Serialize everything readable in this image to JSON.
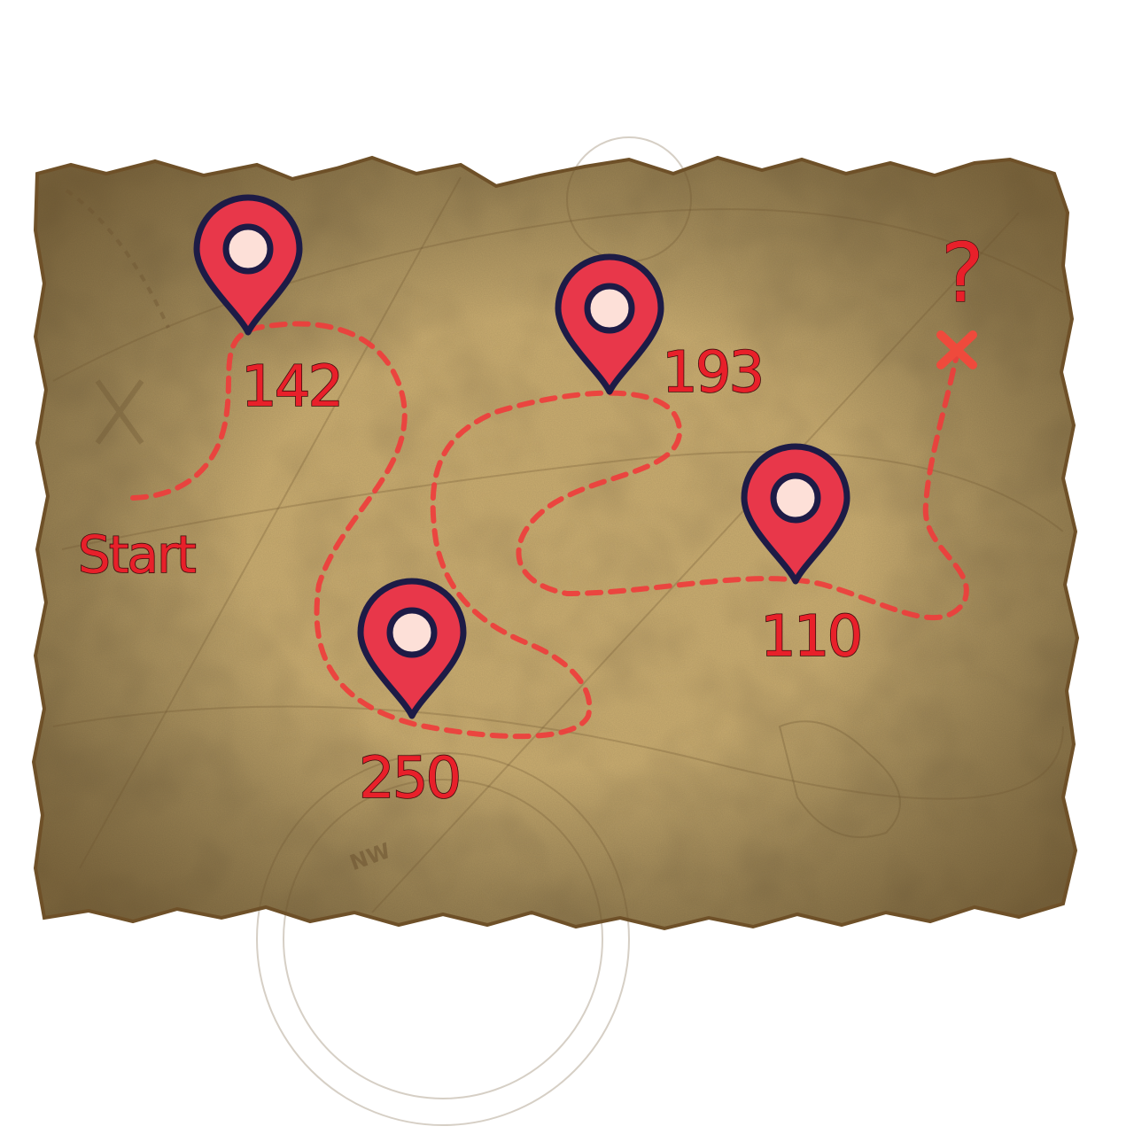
{
  "map": {
    "start_label": "Start",
    "unknown_label": "?",
    "colors": {
      "parchment": "#c9ac6f",
      "parchment_edge": "#6e5028",
      "route": "#ef3b3b",
      "pin_fill": "#e8374a",
      "pin_outline": "#1d1b46",
      "pin_center": "#fde0d8",
      "label_fill": "#e8202a",
      "label_outline": "#3a0c0c"
    },
    "waypoints": [
      {
        "id": "wp1",
        "label": "142",
        "icon": "map-pin-icon"
      },
      {
        "id": "wp2",
        "label": "250",
        "icon": "map-pin-icon"
      },
      {
        "id": "wp3",
        "label": "193",
        "icon": "map-pin-icon"
      },
      {
        "id": "wp4",
        "label": "110",
        "icon": "map-pin-icon"
      }
    ],
    "destination": {
      "icon": "x-mark-icon"
    },
    "background_marks": {
      "compass_text": "NW"
    }
  }
}
